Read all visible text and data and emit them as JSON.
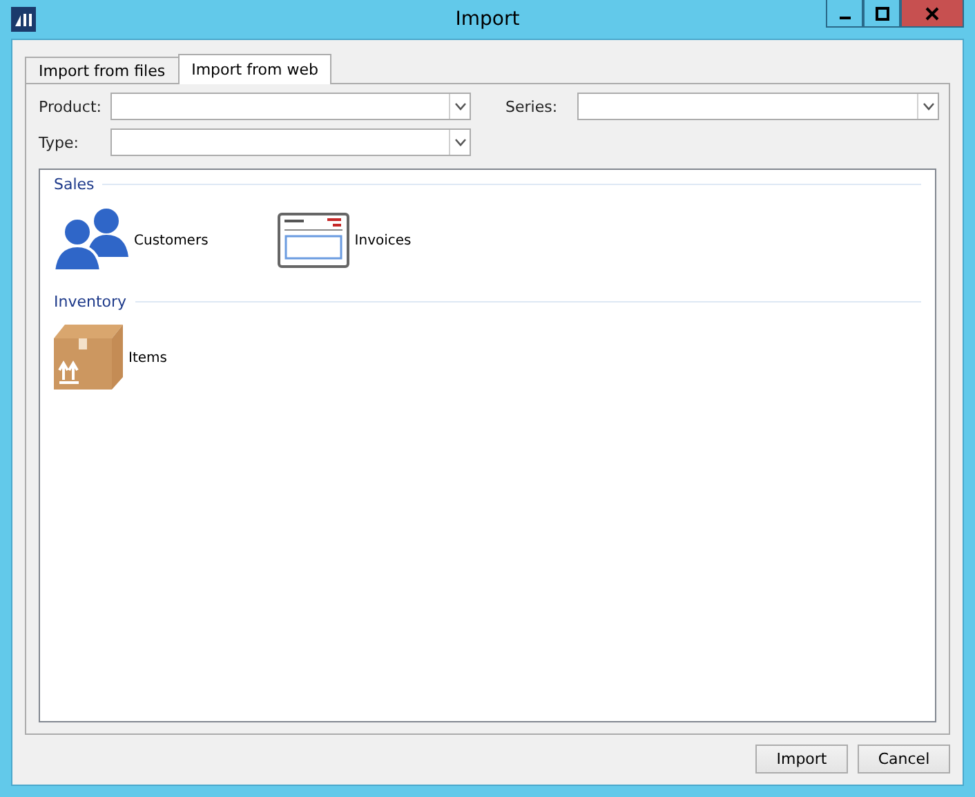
{
  "window": {
    "title": "Import"
  },
  "tabs": [
    {
      "label": "Import from files",
      "selected": false
    },
    {
      "label": "Import from web",
      "selected": true
    }
  ],
  "fields": [
    {
      "label": "Product:"
    },
    {
      "label": "Series:"
    },
    {
      "label": "Type:"
    }
  ],
  "groups": [
    {
      "title": "Sales",
      "items": [
        {
          "label": "Customers",
          "kind": "people"
        },
        {
          "label": "Invoices",
          "kind": "invoice"
        }
      ]
    },
    {
      "title": "Inventory",
      "items": [
        {
          "label": "Items",
          "kind": "box"
        }
      ]
    }
  ],
  "buttons": [
    "Import",
    "Cancel"
  ]
}
